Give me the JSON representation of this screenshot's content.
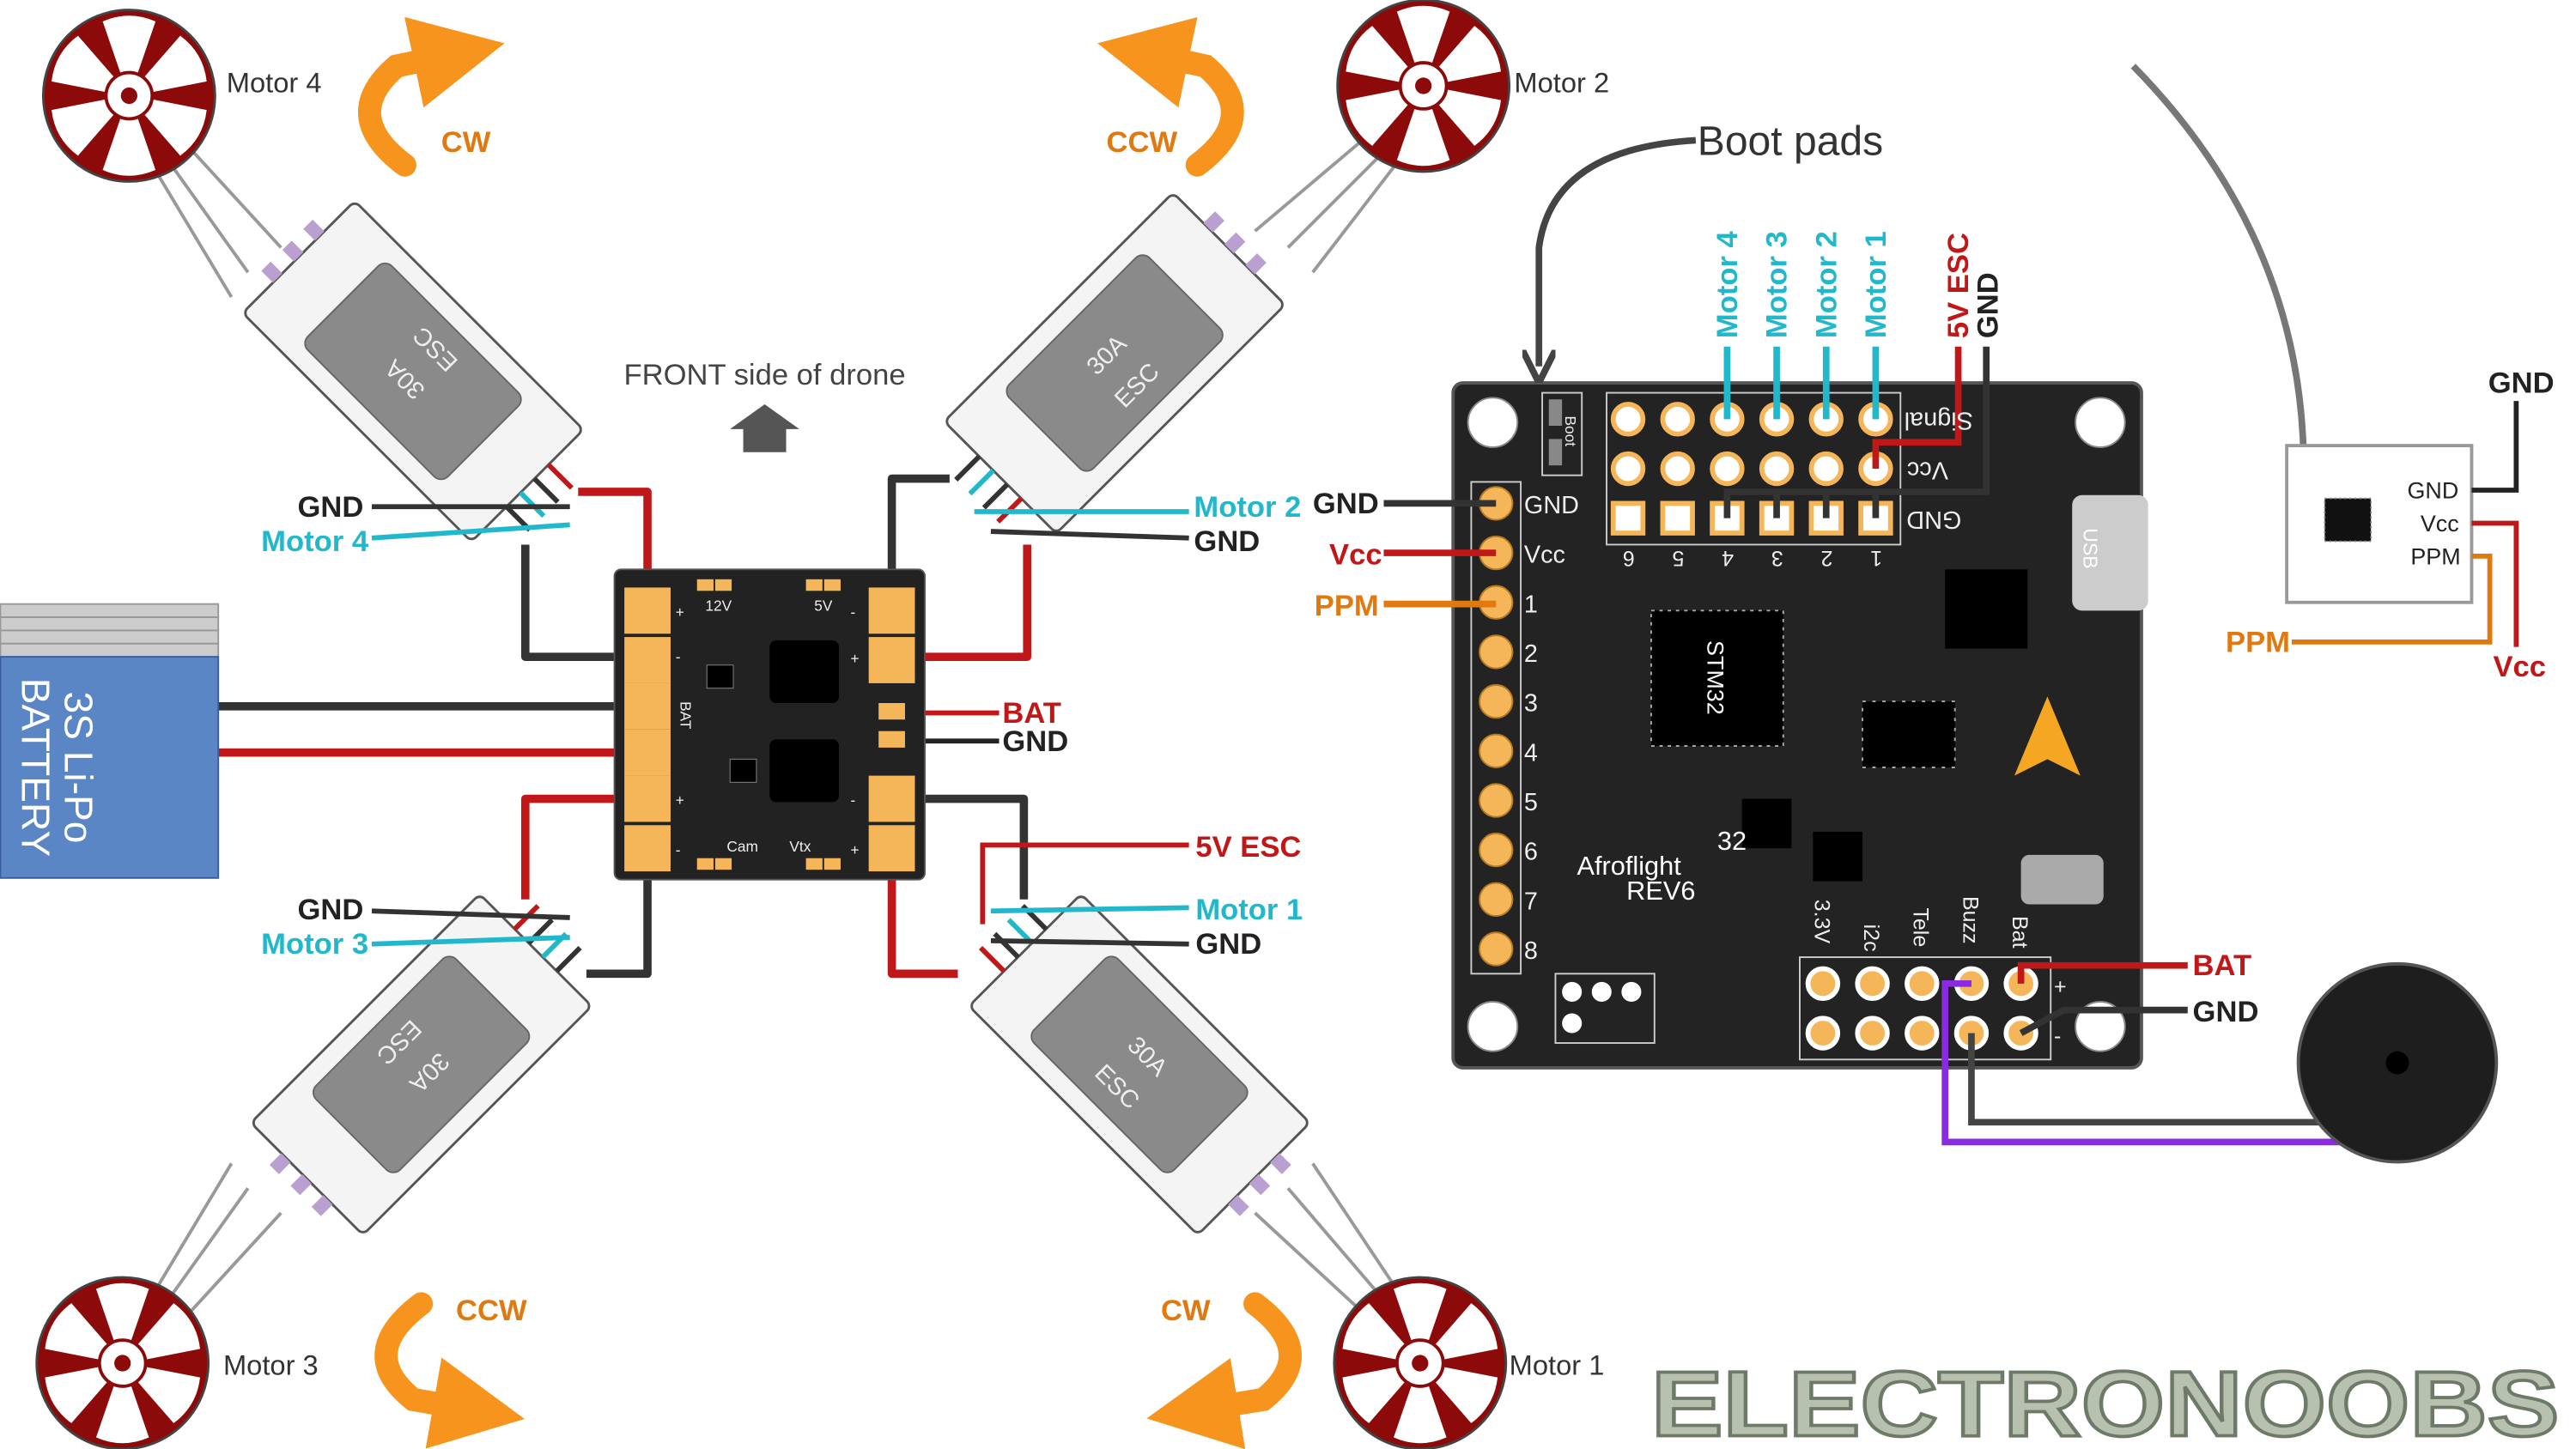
{
  "motors": [
    {
      "label": "Motor 1",
      "direction": "CW"
    },
    {
      "label": "Motor 2",
      "direction": "CCW"
    },
    {
      "label": "Motor 3",
      "direction": "CCW"
    },
    {
      "label": "Motor 4",
      "direction": "CW"
    }
  ],
  "front_label": "FRONT side of drone",
  "esc": {
    "rating": "30A",
    "name": "ESC"
  },
  "battery": {
    "line1": "3S Li-Po",
    "line2": "BATTERY"
  },
  "pdb": {
    "v12": "12V",
    "v5": "5V",
    "bat": "BAT",
    "cam": "Cam",
    "vtx": "Vtx",
    "plus": "+",
    "minus": "-"
  },
  "wire_labels": {
    "left_top_gnd": "GND",
    "left_top_motor": "Motor 4",
    "right_top_motor": "Motor 2",
    "right_top_gnd": "GND",
    "pdb_bat": "BAT",
    "pdb_gnd": "GND",
    "right_bottom_5v": "5V ESC",
    "right_bottom_motor": "Motor 1",
    "right_bottom_gnd": "GND",
    "left_bottom_gnd": "GND",
    "left_bottom_motor": "Motor 3"
  },
  "fc": {
    "boot_pads_label": "Boot pads",
    "boot": "Boot",
    "top_wires": [
      "Motor 4",
      "Motor 3",
      "Motor 2",
      "Motor 1"
    ],
    "top_5v": "5V ESC",
    "top_gnd": "GND",
    "row_labels": [
      "Signal",
      "Vcc",
      "GND"
    ],
    "col_numbers": [
      "6",
      "5",
      "4",
      "3",
      "2",
      "1"
    ],
    "usb": "USB",
    "mcu": "STM32",
    "name_line1": "32",
    "name_line2": "Afroflight",
    "name_line3": "REV6",
    "left_header": [
      "GND",
      "Vcc",
      "1",
      "2",
      "3",
      "4",
      "5",
      "6",
      "7",
      "8"
    ],
    "left_wires": {
      "gnd": "GND",
      "vcc": "Vcc",
      "ppm": "PPM"
    },
    "bottom_header": [
      "3.3V",
      "i2c",
      "Tele",
      "Buzz",
      "Bat"
    ],
    "bottom_plus": "+",
    "bottom_minus": "-",
    "right_wires": {
      "bat": "BAT",
      "gnd": "GND"
    }
  },
  "receiver": {
    "pins": [
      "GND",
      "Vcc",
      "PPM"
    ],
    "wire_gnd": "GND",
    "wire_ppm": "PPM",
    "wire_vcc": "Vcc"
  },
  "logo": "ELECTRONOOBS",
  "colors": {
    "motor": "#8c0a0a",
    "arrow": "#f7941d",
    "signal": "#22b8cc",
    "power": "#c01818",
    "ground": "#333333",
    "ppm": "#e07a10",
    "pad": "#f5b65a",
    "board": "#222222",
    "battery": "#5b86c6",
    "buzzer_wire": "#8a2be2"
  }
}
